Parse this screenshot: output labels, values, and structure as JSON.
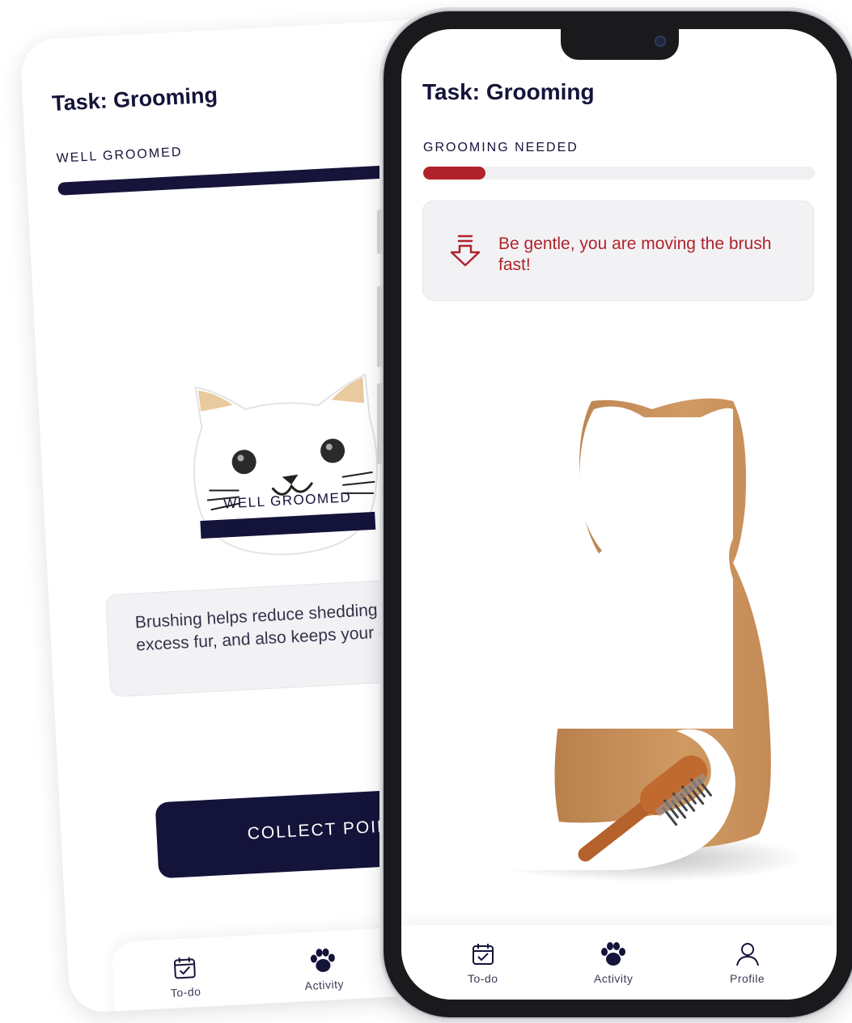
{
  "back": {
    "title": "Task: Grooming",
    "status_label": "WELL GROOMED",
    "cat_label": "WELL GROOMED",
    "progress": 1.0,
    "info_text": "Brushing helps reduce shedding by removing excess fur, and also keeps your cat clean.",
    "collect_label": "COLLECT POINTS",
    "nav": {
      "todo": "To-do",
      "activity": "Activity"
    }
  },
  "front": {
    "title": "Task: Grooming",
    "status_label": "GROOMING NEEDED",
    "progress": 0.16,
    "alert_text": "Be gentle, you are moving the brush fast!",
    "nav": {
      "todo": "To-do",
      "activity": "Activity",
      "profile": "Profile"
    }
  },
  "colors": {
    "navy": "#14133a",
    "alert_red": "#b0232a",
    "card_bg": "#f2f2f5",
    "cat_tan": "#c98f57"
  },
  "icons": [
    "calendar-check-icon",
    "paw-icon",
    "user-icon",
    "arrow-down-lines-icon",
    "brush-icon"
  ]
}
